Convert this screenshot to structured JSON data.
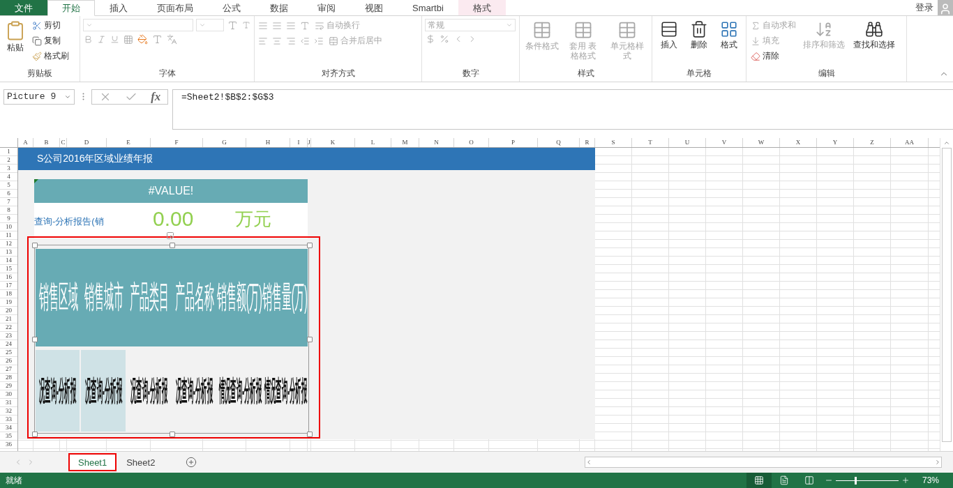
{
  "window": {
    "signin": "登录"
  },
  "tabs": [
    {
      "label": "文件",
      "kind": "file",
      "selected": false
    },
    {
      "label": "开始",
      "kind": "tab",
      "selected": true
    },
    {
      "label": "插入",
      "kind": "tab",
      "selected": false
    },
    {
      "label": "页面布局",
      "kind": "tab",
      "selected": false
    },
    {
      "label": "公式",
      "kind": "tab",
      "selected": false
    },
    {
      "label": "数据",
      "kind": "tab",
      "selected": false
    },
    {
      "label": "审阅",
      "kind": "tab",
      "selected": false
    },
    {
      "label": "视图",
      "kind": "tab",
      "selected": false
    },
    {
      "label": "Smartbi",
      "kind": "tab",
      "selected": false
    },
    {
      "label": "格式",
      "kind": "context",
      "selected": false
    }
  ],
  "ribbon": {
    "groups": [
      {
        "kind": "clipboard",
        "title": "剪贴板",
        "items": [
          {
            "label": "粘贴",
            "disabled": false
          },
          {
            "label": "剪切",
            "disabled": false
          },
          {
            "label": "复制",
            "disabled": false
          },
          {
            "label": "格式刷",
            "disabled": false
          }
        ]
      },
      {
        "kind": "font",
        "title": "字体"
      },
      {
        "kind": "alignment",
        "title": "对齐方式",
        "items": [
          {
            "label": "自动换行",
            "disabled": true
          },
          {
            "label": "合并后居中",
            "disabled": true
          }
        ]
      },
      {
        "kind": "number",
        "title": "数字",
        "items": [
          {
            "label": "常规",
            "disabled": true
          }
        ]
      },
      {
        "kind": "styles",
        "title": "样式",
        "items": [
          {
            "label": "条件格式",
            "disabled": true
          },
          {
            "label": "套用 表格格式",
            "disabled": true
          },
          {
            "label": "单元格样式",
            "disabled": true
          }
        ]
      },
      {
        "kind": "cells",
        "title": "单元格",
        "items": [
          {
            "label": "插入",
            "disabled": false
          },
          {
            "label": "删除",
            "disabled": false
          },
          {
            "label": "格式",
            "disabled": false
          }
        ]
      },
      {
        "kind": "editing",
        "title": "编辑",
        "items": [
          {
            "label": "自动求和",
            "disabled": true
          },
          {
            "label": "填充",
            "disabled": true
          },
          {
            "label": "清除",
            "disabled": false
          },
          {
            "label": "排序和筛选",
            "disabled": true
          },
          {
            "label": "查找和选择",
            "disabled": false
          }
        ]
      }
    ]
  },
  "formula_bar": {
    "name_box": "Picture 9",
    "function_label": "fx",
    "formula": "=Sheet2!$B$2:$G$3"
  },
  "sheet": {
    "columns": [
      "A",
      "B",
      "C",
      "D",
      "E",
      "F",
      "G",
      "H",
      "I",
      "J",
      "K",
      "L",
      "M",
      "N",
      "O",
      "P",
      "Q",
      "R",
      "S",
      "T",
      "U",
      "V",
      "W",
      "X",
      "Y",
      "Z",
      "AA"
    ],
    "rows": [
      "1",
      "2",
      "3",
      "4",
      "5",
      "6",
      "7",
      "8",
      "9",
      "10",
      "11",
      "12",
      "13",
      "14",
      "15",
      "16",
      "17",
      "18",
      "19",
      "20",
      "21",
      "22",
      "23",
      "24",
      "25",
      "26",
      "27",
      "28",
      "29",
      "30",
      "31",
      "32",
      "33",
      "34",
      "35",
      "36"
    ],
    "banner": "S公司2016年区域业绩年报",
    "header": "#VALUE!",
    "link": "查询-分析报告(销",
    "amount": "0.00",
    "unit": "万元",
    "picture": {
      "headers": [
        "销售区域",
        "销售城市",
        "产品类目",
        "产品名称",
        "销售额(万)",
        "销售量(万)"
      ],
      "cells": [
        {
          "text": "况查询-分析报",
          "highlighted": true
        },
        {
          "text": "况查询-分析报",
          "highlighted": true
        },
        {
          "text": "况查询-分析报",
          "highlighted": false
        },
        {
          "text": "况查询-分析报",
          "highlighted": false
        },
        {
          "text": "情况查询-分析报",
          "highlighted": false
        },
        {
          "text": "情况查询-分析报",
          "highlighted": false
        }
      ]
    }
  },
  "sheet_tabs": [
    {
      "label": "Sheet1",
      "selected": true
    },
    {
      "label": "Sheet2",
      "selected": false
    }
  ],
  "status_bar": {
    "text": "就绪",
    "views": [
      {
        "kind": "normal",
        "selected": true
      },
      {
        "kind": "page_layout",
        "selected": false
      },
      {
        "kind": "page_break",
        "selected": false
      }
    ],
    "zoom": {
      "reading": "73%",
      "level": 0.3
    }
  }
}
